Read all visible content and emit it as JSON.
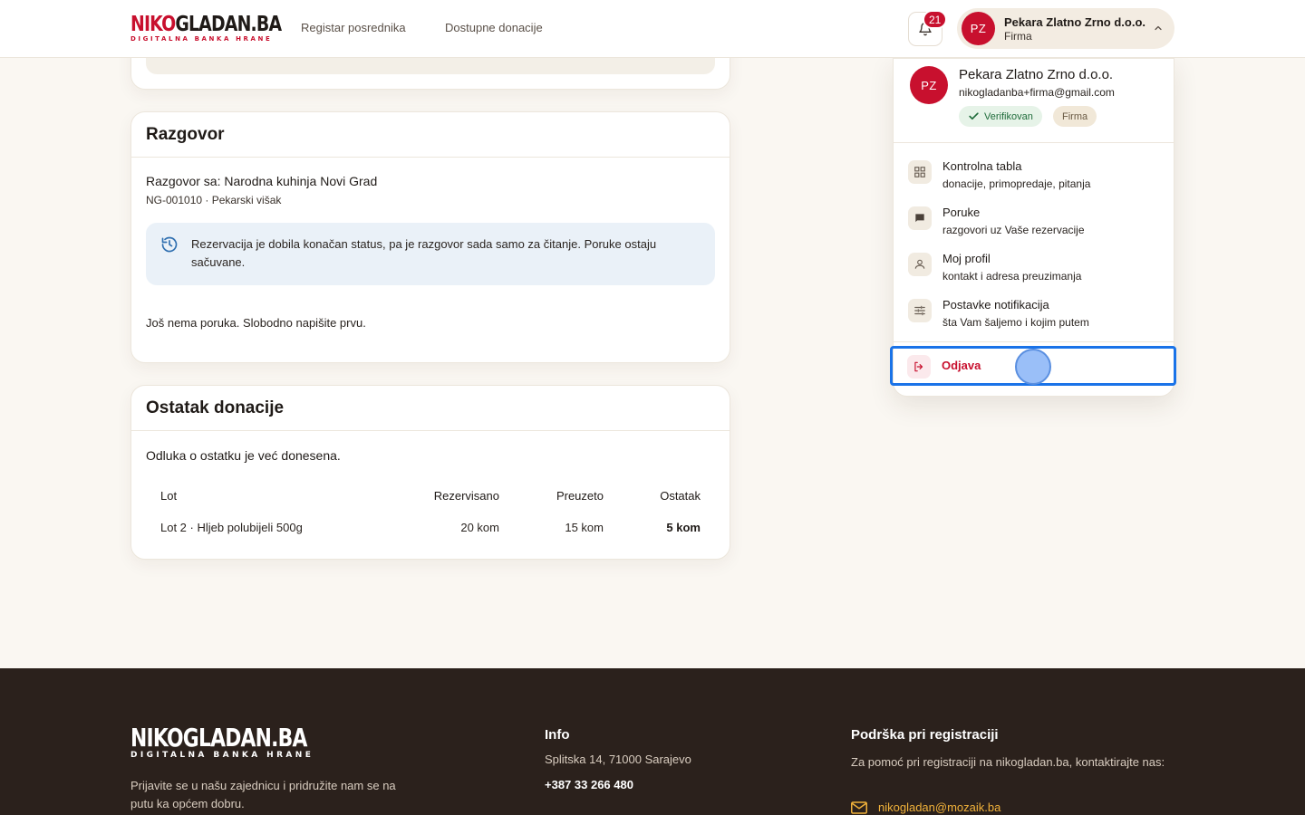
{
  "brand": {
    "logo_main_red": "NIKO",
    "logo_main_dark": "GLADAN.BA",
    "logo_sub": "DIGITALNA BANKA HRANE"
  },
  "nav": {
    "links": [
      "Registar posrednika",
      "Dostupne donacije"
    ]
  },
  "notifications": {
    "count": "21"
  },
  "user": {
    "initials": "PZ",
    "name": "Pekara Zlatno Zrno d.o.o.",
    "role": "Firma",
    "email": "nikogladanba+firma@gmail.com"
  },
  "dropdown": {
    "badge_verified": "Verifikovan",
    "badge_type": "Firma",
    "items": [
      {
        "label": "Kontrolna tabla",
        "desc": "donacije, primopredaje, pitanja",
        "icon": "dashboard-icon"
      },
      {
        "label": "Poruke",
        "desc": "razgovori uz Vaše rezervacije",
        "icon": "chat-icon"
      },
      {
        "label": "Moj profil",
        "desc": "kontakt i adresa preuzimanja",
        "icon": "person-icon"
      },
      {
        "label": "Postavke notifikacija",
        "desc": "šta Vam šaljemo i kojim putem",
        "icon": "tune-icon"
      }
    ],
    "logout_label": "Odjava"
  },
  "chat": {
    "title": "Razgovor",
    "with": "Razgovor sa: Narodna kuhinja Novi Grad",
    "meta": "NG-001010 · Pekarski višak",
    "info": "Rezervacija je dobila konačan status, pa je razgovor sada samo za čitanje. Poruke ostaju sačuvane.",
    "empty": "Još nema poruka. Slobodno napišite prvu."
  },
  "remainder": {
    "title": "Ostatak donacije",
    "decision": "Odluka o ostatku je već donesena.",
    "headers": [
      "Lot",
      "Rezervisano",
      "Preuzeto",
      "Ostatak"
    ],
    "rows": [
      [
        "Lot 2 · Hljeb polubijeli 500g",
        "20 kom",
        "15 kom",
        "5 kom"
      ]
    ]
  },
  "footer": {
    "logo_main": "NIKOGLADAN.BA",
    "logo_sub": "DIGITALNA BANKA HRANE",
    "tagline": "Prijavite se u našu zajednicu i pridružite nam se na putu ka općem dobru.",
    "info_title": "Info",
    "address": "Splitska 14, 71000 Sarajevo",
    "phone": "+387 33 266 480",
    "support_title": "Podrška pri registraciji",
    "support_text": "Za pomoć pri registraciji na nikogladan.ba, kontaktirajte nas:",
    "support_email": "nikogladan@mozaik.ba"
  }
}
